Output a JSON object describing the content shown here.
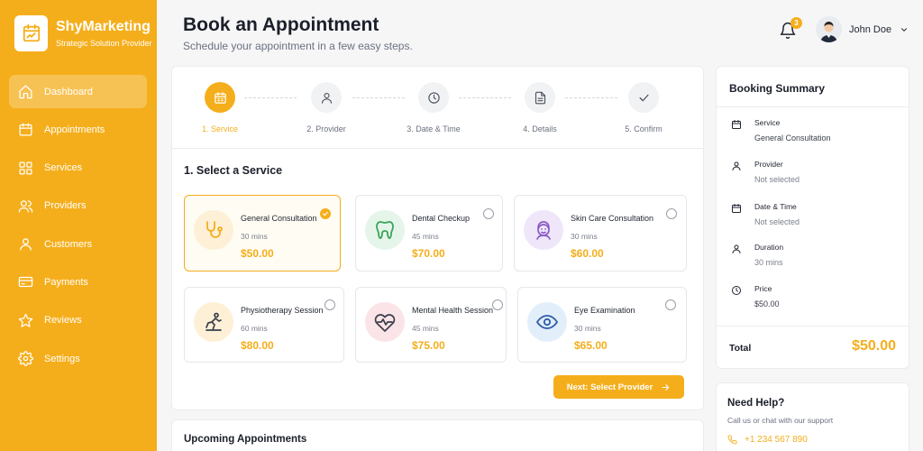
{
  "brand": {
    "name": "ShyMarketing",
    "tagline": "Strategic Solution Provider"
  },
  "nav": [
    {
      "label": "Dashboard",
      "icon": "home-icon",
      "active": true
    },
    {
      "label": "Appointments",
      "icon": "calendar-icon"
    },
    {
      "label": "Services",
      "icon": "grid-icon"
    },
    {
      "label": "Providers",
      "icon": "users-icon"
    },
    {
      "label": "Customers",
      "icon": "user-icon"
    },
    {
      "label": "Payments",
      "icon": "card-icon"
    },
    {
      "label": "Reviews",
      "icon": "star-icon"
    },
    {
      "label": "Settings",
      "icon": "gear-icon"
    }
  ],
  "header": {
    "title": "Book an Appointment",
    "subtitle": "Schedule your appointment in a few easy steps.",
    "notification_count": "3",
    "user_name": "John Doe"
  },
  "steps": [
    {
      "label": "1. Service",
      "icon": "calendar-icon",
      "active": true
    },
    {
      "label": "2. Provider",
      "icon": "user-icon"
    },
    {
      "label": "3. Date & Time",
      "icon": "clock-icon"
    },
    {
      "label": "4. Details",
      "icon": "document-icon"
    },
    {
      "label": "5. Confirm",
      "icon": "check-icon"
    }
  ],
  "section_title": "1. Select a Service",
  "services": [
    {
      "name": "General Consultation",
      "duration": "30 mins",
      "price": "$50.00",
      "icon": "stethoscope-icon",
      "selected": true
    },
    {
      "name": "Dental Checkup",
      "duration": "45 mins",
      "price": "$70.00",
      "icon": "tooth-icon"
    },
    {
      "name": "Skin Care Consultation",
      "duration": "30 mins",
      "price": "$60.00",
      "icon": "face-icon"
    },
    {
      "name": "Physiotherapy Session",
      "duration": "60 mins",
      "price": "$80.00",
      "icon": "physio-icon"
    },
    {
      "name": "Mental Health Session",
      "duration": "45 mins",
      "price": "$75.00",
      "icon": "heart-pulse-icon"
    },
    {
      "name": "Eye Examination",
      "duration": "30 mins",
      "price": "$65.00",
      "icon": "eye-icon"
    }
  ],
  "next_button": "Next: Select Provider",
  "upcoming_title": "Upcoming Appointments",
  "summary": {
    "title": "Booking Summary",
    "rows": [
      {
        "label": "Service",
        "value": "General Consultation",
        "icon": "calendar-icon"
      },
      {
        "label": "Provider",
        "value": "Not selected",
        "icon": "user-icon"
      },
      {
        "label": "Date & Time",
        "value": "Not selected",
        "icon": "calendar-icon"
      },
      {
        "label": "Duration",
        "value": "30 mins",
        "icon": "user-icon"
      },
      {
        "label": "Price",
        "value": "$50.00",
        "icon": "clock-icon"
      }
    ],
    "total_label": "Total",
    "total_value": "$50.00"
  },
  "help": {
    "title": "Need Help?",
    "subtitle": "Call us or chat with our support",
    "phone": "+1 234 567 890"
  },
  "colors": {
    "accent": "#f5ae1b",
    "background": "#f6f6f7"
  }
}
